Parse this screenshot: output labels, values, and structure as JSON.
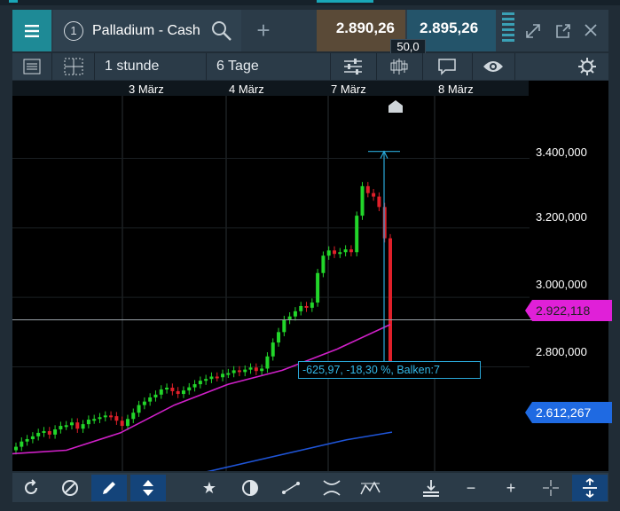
{
  "instrument": {
    "tab_number": "1",
    "name": "Palladium - Cash",
    "sell_price": "2.890,26",
    "buy_price": "2.895,26",
    "spread": "50,0"
  },
  "toolbar": {
    "interval": "1 stunde",
    "range": "6 Tage"
  },
  "chart": {
    "dates": [
      "3 März",
      "4 März",
      "7 März",
      "8 März"
    ],
    "price_labels": [
      "3.400,000",
      "3.200,000",
      "3.000,000",
      "2.800,000"
    ],
    "ma_short_tag": "2.922,118",
    "ma_long_tag": "2.612,267",
    "measure_label": "-625,97, -18,30 %, Balken:7",
    "colors": {
      "bull": "#22d62a",
      "bear": "#e0202a",
      "ma_short": "#d020c8",
      "ma_long": "#1f55d8",
      "measure": "#2aa8d8"
    }
  },
  "chart_data": {
    "type": "candlestick",
    "title": "",
    "ylim": [
      2500,
      3580
    ],
    "x_ticks": [
      "3 März",
      "4 März",
      "7 März",
      "8 März"
    ],
    "y_ticks": [
      2800,
      3000,
      3200,
      3400
    ],
    "closes": [
      2570,
      2585,
      2592,
      2600,
      2610,
      2615,
      2605,
      2620,
      2630,
      2632,
      2640,
      2622,
      2635,
      2648,
      2650,
      2655,
      2660,
      2658,
      2645,
      2630,
      2650,
      2668,
      2690,
      2700,
      2712,
      2720,
      2735,
      2740,
      2730,
      2722,
      2732,
      2741,
      2750,
      2760,
      2765,
      2772,
      2770,
      2780,
      2782,
      2790,
      2785,
      2792,
      2798,
      2788,
      2795,
      2830,
      2870,
      2900,
      2935,
      2945,
      2960,
      2975,
      2970,
      2985,
      3070,
      3120,
      3135,
      3125,
      3130,
      3138,
      3130,
      3235,
      3320,
      3300,
      3290,
      3260,
      3170,
      2790
    ],
    "ma_short": [
      2550,
      2560,
      2610,
      2690,
      2750,
      2790,
      2850,
      2922
    ],
    "ma_long": [
      2450,
      2470,
      2500,
      2530,
      2560,
      2590,
      2612
    ],
    "reference_line": 2890.26,
    "measure": {
      "from": 3420,
      "to": 2790,
      "change": "-625,97",
      "percent": "-18,30 %",
      "bars": 7
    }
  }
}
